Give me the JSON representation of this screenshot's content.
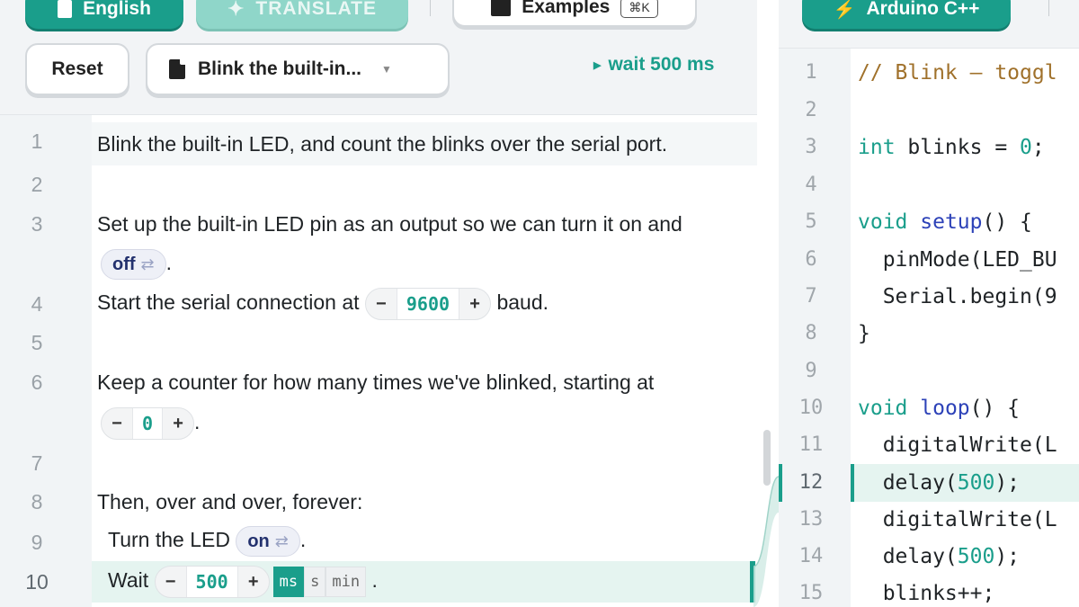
{
  "left_toolbar": {
    "language_button": "English",
    "translate_button": "TRANSLATE",
    "examples_button": "Examples",
    "examples_shortcut": "⌘K",
    "reset_button": "Reset",
    "program_select": "Blink the built-in...",
    "status": "wait 500 ms"
  },
  "prose": {
    "line_numbers": [
      "1",
      "2",
      "3",
      "4",
      "5",
      "6",
      "7",
      "8",
      "9",
      "10"
    ],
    "line1": "Blink the built-in LED, and count the blinks over the serial port.",
    "line3": "Set up the built-in LED pin as an output so we can turn it on and",
    "line3_chip": "off",
    "line4_before": "Start the serial connection at",
    "line4_value": "9600",
    "line4_after": "baud.",
    "line6": "Keep a counter for how many times we've blinked, starting at",
    "line6_value": "0",
    "line8": "Then, over and over, forever:",
    "line9_before": "Turn the LED",
    "line9_chip": "on",
    "line10_before": "Wait",
    "line10_value": "500",
    "units": [
      "ms",
      "s",
      "min"
    ],
    "active_unit": "ms",
    "period": ".",
    "minus": "−",
    "plus": "+",
    "swap_glyph": "⇄"
  },
  "right_toolbar": {
    "language_button": "Arduino C++"
  },
  "code": {
    "line_numbers": [
      "1",
      "2",
      "3",
      "4",
      "5",
      "6",
      "7",
      "8",
      "9",
      "10",
      "11",
      "12",
      "13",
      "14",
      "15"
    ],
    "l1": "// Blink — toggl",
    "l3_kw": "int",
    "l3_rest": " blinks = ",
    "l3_num": "0",
    "l3_end": ";",
    "l5_kw": "void",
    "l5_fn": "setup",
    "l5_end": "() {",
    "l6": "  pinMode(LED_BU",
    "l7": "  Serial.begin(9",
    "l8": "}",
    "l10_kw": "void",
    "l10_fn": "loop",
    "l10_end": "() {",
    "l11": "  digitalWrite(L",
    "l12_a": "  delay(",
    "l12_num": "500",
    "l12_b": ");",
    "l13": "  digitalWrite(L",
    "l14_a": "  delay(",
    "l14_num": "500",
    "l14_b": ");",
    "l15": "  blinks++;"
  },
  "colors": {
    "accent": "#1a9e8b",
    "keyword": "#1a9e8b",
    "function": "#2d42b8",
    "comment": "#a0712b"
  },
  "icons": [
    "document-icon",
    "magic-wand-icon",
    "book-icon",
    "file-icon",
    "caret-down-icon",
    "play-caret-icon",
    "swap-icon",
    "bolt-icon"
  ]
}
